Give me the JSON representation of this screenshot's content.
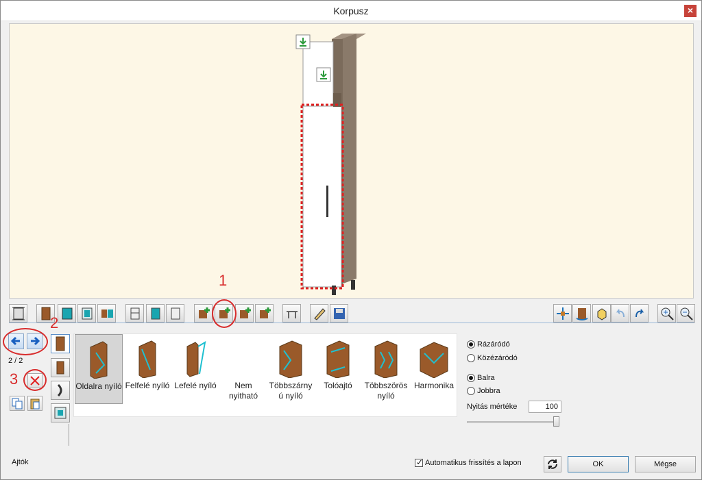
{
  "window": {
    "title": "Korpusz",
    "close_label": "×"
  },
  "toolbar": {
    "icons": [
      "dimensions-icon",
      "cabinet-front-icon",
      "cabinet-teal-icon",
      "cabinet-frame-icon",
      "split-icon",
      "shelf-icon",
      "corner-icon",
      "box-icon",
      "add-shelf-icon",
      "add-door-icon",
      "add-drawer-icon",
      "add-panel-icon",
      "legs-icon",
      "edit-icon",
      "save-icon",
      "move-icon",
      "rotate-cabinet-icon",
      "cube-icon",
      "undo-icon",
      "redo-icon",
      "zoom-in-icon",
      "zoom-out-icon"
    ]
  },
  "navigation": {
    "page_count": "2 / 2"
  },
  "door_types": [
    {
      "label": "Oldalra nyíló",
      "selected": true
    },
    {
      "label": "Felfelé nyíló",
      "selected": false
    },
    {
      "label": "Lefelé nyíló",
      "selected": false
    },
    {
      "label": "Nem nyitható",
      "selected": false
    },
    {
      "label": "Többszárny ú nyíló",
      "selected": false
    },
    {
      "label": "Tolóajtó",
      "selected": false
    },
    {
      "label": "Többszörös nyíló",
      "selected": false
    },
    {
      "label": "Harmonika",
      "selected": false
    }
  ],
  "options": {
    "closing": [
      {
        "label": "Rázáródó",
        "checked": true
      },
      {
        "label": "Közézáródó",
        "checked": false
      }
    ],
    "direction": [
      {
        "label": "Balra",
        "checked": true
      },
      {
        "label": "Jobbra",
        "checked": false
      }
    ],
    "opening_label": "Nyitás mértéke",
    "opening_value": "100",
    "opening_fraction": 1.0
  },
  "status": {
    "label": "Ajtók"
  },
  "footer": {
    "auto_refresh_label": "Automatikus frissítés a lapon",
    "auto_refresh_checked": true,
    "ok_label": "OK",
    "cancel_label": "Mégse"
  },
  "annotations": {
    "one": "1",
    "two": "2",
    "three": "3"
  },
  "colors": {
    "accent": "#3c7fb1",
    "annotation": "#d82c2c",
    "wood": "#8a7a6a",
    "door_wood": "#9a5a2a",
    "teal": "#1aa5b0"
  }
}
